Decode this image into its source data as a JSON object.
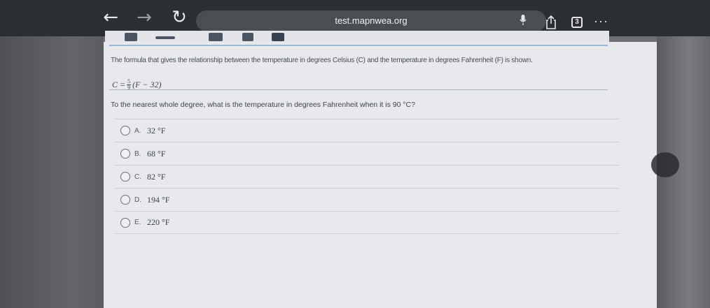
{
  "browser": {
    "url": "test.mapnwea.org",
    "back_icon": "←",
    "forward_icon": "→",
    "reload_icon": "↻",
    "tab_count": "3",
    "more_icon": "···"
  },
  "question": {
    "intro": "The formula that gives the relationship between the temperature in degrees Celsius (C) and the temperature in degrees Fahrenheit (F) is shown.",
    "formula_left": "C =",
    "formula_num": "5",
    "formula_den": "9",
    "formula_right": "(F − 32)",
    "prompt": "To the nearest whole degree, what is the temperature in degrees Fahrenheit when it is 90 °C?"
  },
  "choices": [
    {
      "letter": "A.",
      "value": "32 °F"
    },
    {
      "letter": "B.",
      "value": "68 °F"
    },
    {
      "letter": "C.",
      "value": "82 °F"
    },
    {
      "letter": "D.",
      "value": "194 °F"
    },
    {
      "letter": "E.",
      "value": "220 °F"
    }
  ]
}
